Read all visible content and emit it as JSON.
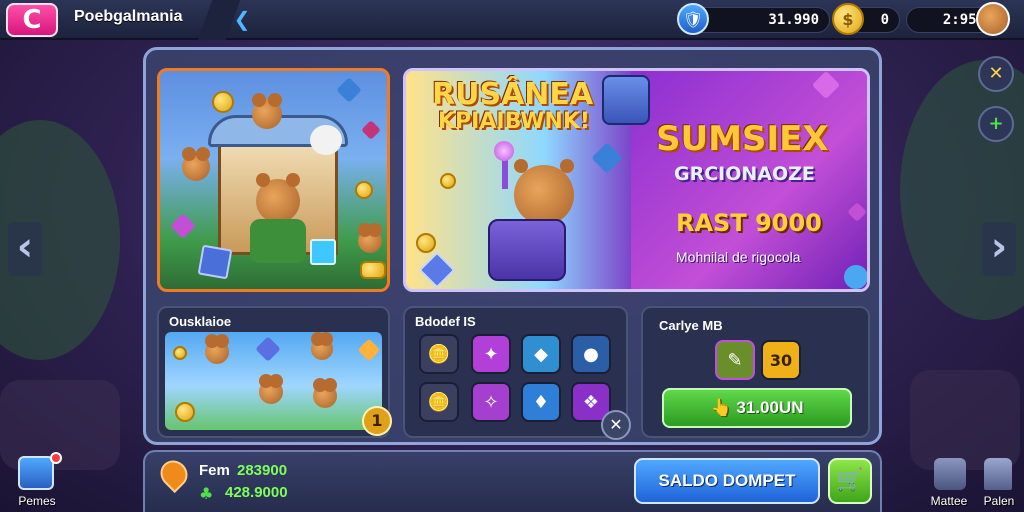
{
  "header": {
    "title": "Poebgalmania",
    "logo_glyph": "C",
    "back_glyph": "❮"
  },
  "resources": [
    {
      "icon": "shield-icon",
      "value": "31.990"
    },
    {
      "icon": "coin-icon",
      "value": "0"
    },
    {
      "icon": "bear-avatar-icon",
      "value": "2:953"
    }
  ],
  "banners": {
    "featured": {
      "title_line1": "RUSÂNEA",
      "title_line2": "KPIAIBWNK!"
    },
    "promo": {
      "title": "SUMSIEX",
      "subtitle": "GRCIONAOZE",
      "offer": "RAST 9000",
      "tagline": "Mohnilal de rigocola"
    }
  },
  "panels": {
    "collection": {
      "label": "Ousklaioe",
      "badge": "1"
    },
    "items": {
      "label": "Bdodef IS",
      "close_glyph": "✕"
    },
    "craft": {
      "label": "Carlye MB",
      "slot_value": "30",
      "buy_label": "31.00UN"
    }
  },
  "side_buttons": {
    "close_glyph": "✕",
    "add_glyph": "+"
  },
  "nav": {
    "prev": "‹",
    "next": "›"
  },
  "bottom": {
    "line1_label": "Fem",
    "line1_value": "283900",
    "line2_value": "428.9000",
    "main_button": "SALDO DOMPET"
  },
  "corners": {
    "left_label": "Pemes",
    "right_label_1": "Mattee",
    "right_label_2": "Palen"
  },
  "colors": {
    "accent_pink": "#ff4fa8",
    "accent_blue": "#2f7ef0",
    "accent_green": "#4fc83a",
    "gold": "#ffcf3a"
  }
}
